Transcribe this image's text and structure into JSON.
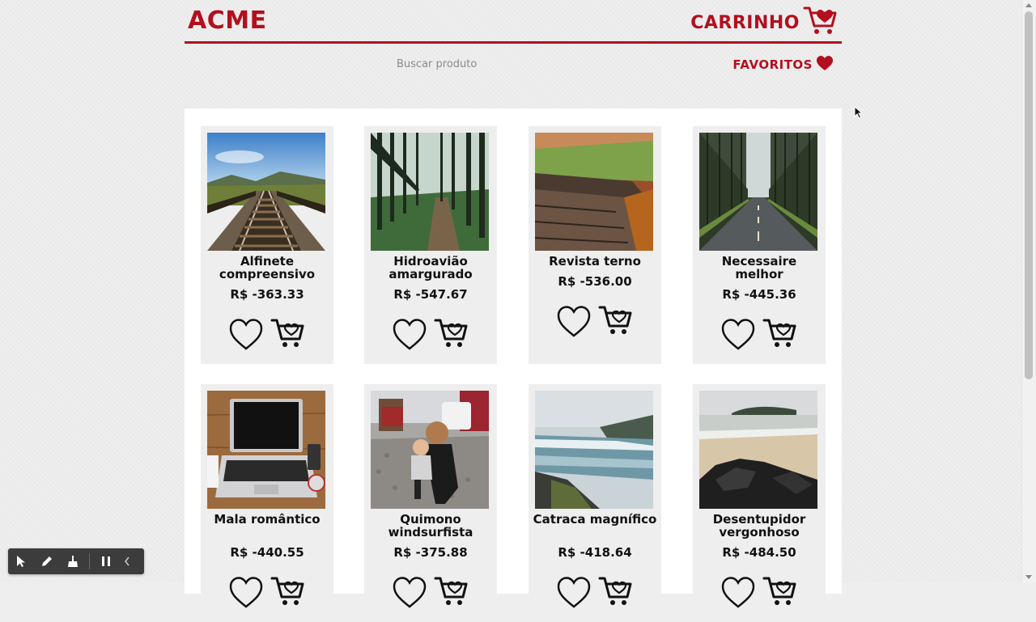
{
  "header": {
    "logo": "ACME",
    "cart_label": "CARRINHO"
  },
  "search": {
    "placeholder": "Buscar produto"
  },
  "favorites": {
    "label": "FAVORITOS"
  },
  "products": [
    {
      "name": "Alfinete compreensivo",
      "price": "R$ -363.33",
      "image": "railroad-tracks"
    },
    {
      "name": "Hidroavião amargurado",
      "price": "R$ -547.67",
      "image": "forest-path"
    },
    {
      "name": "Revista terno",
      "price": "R$ -536.00",
      "image": "mossy-log"
    },
    {
      "name": "Necessaire melhor",
      "price": "R$ -445.36",
      "image": "tree-lined-road"
    },
    {
      "name": "Mala romântico",
      "price": "R$ -440.55",
      "image": "laptop-on-desk"
    },
    {
      "name": "Quimono windsurfista",
      "price": "R$ -375.88",
      "image": "mother-and-child"
    },
    {
      "name": "Catraca magnífico",
      "price": "R$ -418.64",
      "image": "river-rocks"
    },
    {
      "name": "Desentupidor vergonhoso",
      "price": "R$ -484.50",
      "image": "beach-rocks"
    }
  ],
  "colors": {
    "brand": "#b30f1e",
    "card_bg": "#eeeeee",
    "main_bg": "#ffffff"
  }
}
